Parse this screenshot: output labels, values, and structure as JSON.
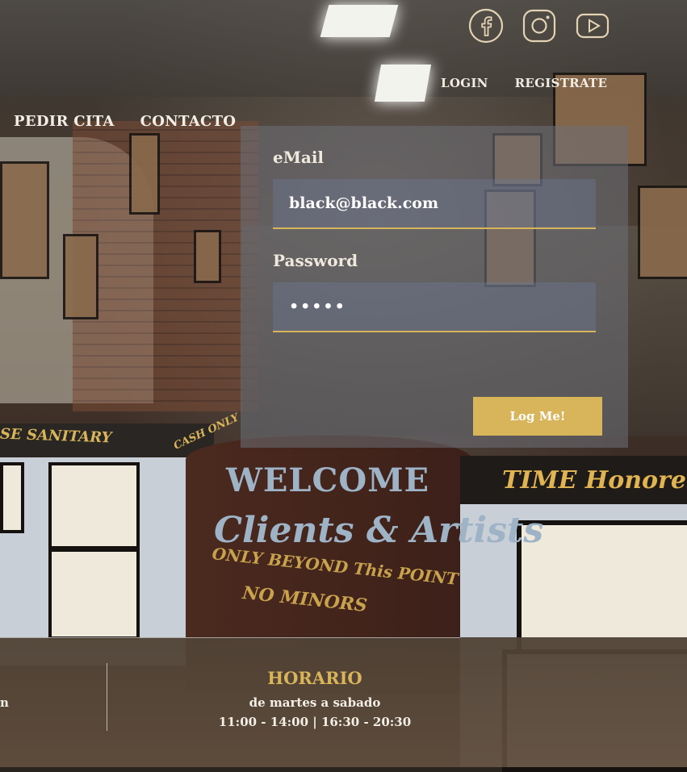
{
  "social": {
    "icons": [
      "facebook-icon",
      "instagram-icon",
      "youtube-icon"
    ]
  },
  "top_nav": {
    "login": "LOGIN",
    "register": "REGISTRATE"
  },
  "main_nav": {
    "book": "PEDIR CITA",
    "contact": "CONTACTO"
  },
  "login_form": {
    "email_label": "eMail",
    "email_value": "black@black.com",
    "password_label": "Password",
    "password_value": "•••••",
    "submit_label": "Log Me!"
  },
  "footer": {
    "left_fragment": "n",
    "schedule_title": "HORARIO",
    "schedule_days": "de martes a sabado",
    "schedule_hours": "11:00 - 14:00 | 16:30 - 20:30"
  },
  "background_signs": {
    "sanitary": "SE SANITARY",
    "cash": "CASH ONLY",
    "welcome": "WELCOME",
    "clients": "Clients & Artists",
    "beyond": "ONLY BEYOND This POINT",
    "minors": "NO MINORS",
    "time": "TIME Honore"
  },
  "colors": {
    "accent": "#d8b45a",
    "panel": "rgba(110,112,120,0.55)",
    "text": "#f4efe6"
  }
}
